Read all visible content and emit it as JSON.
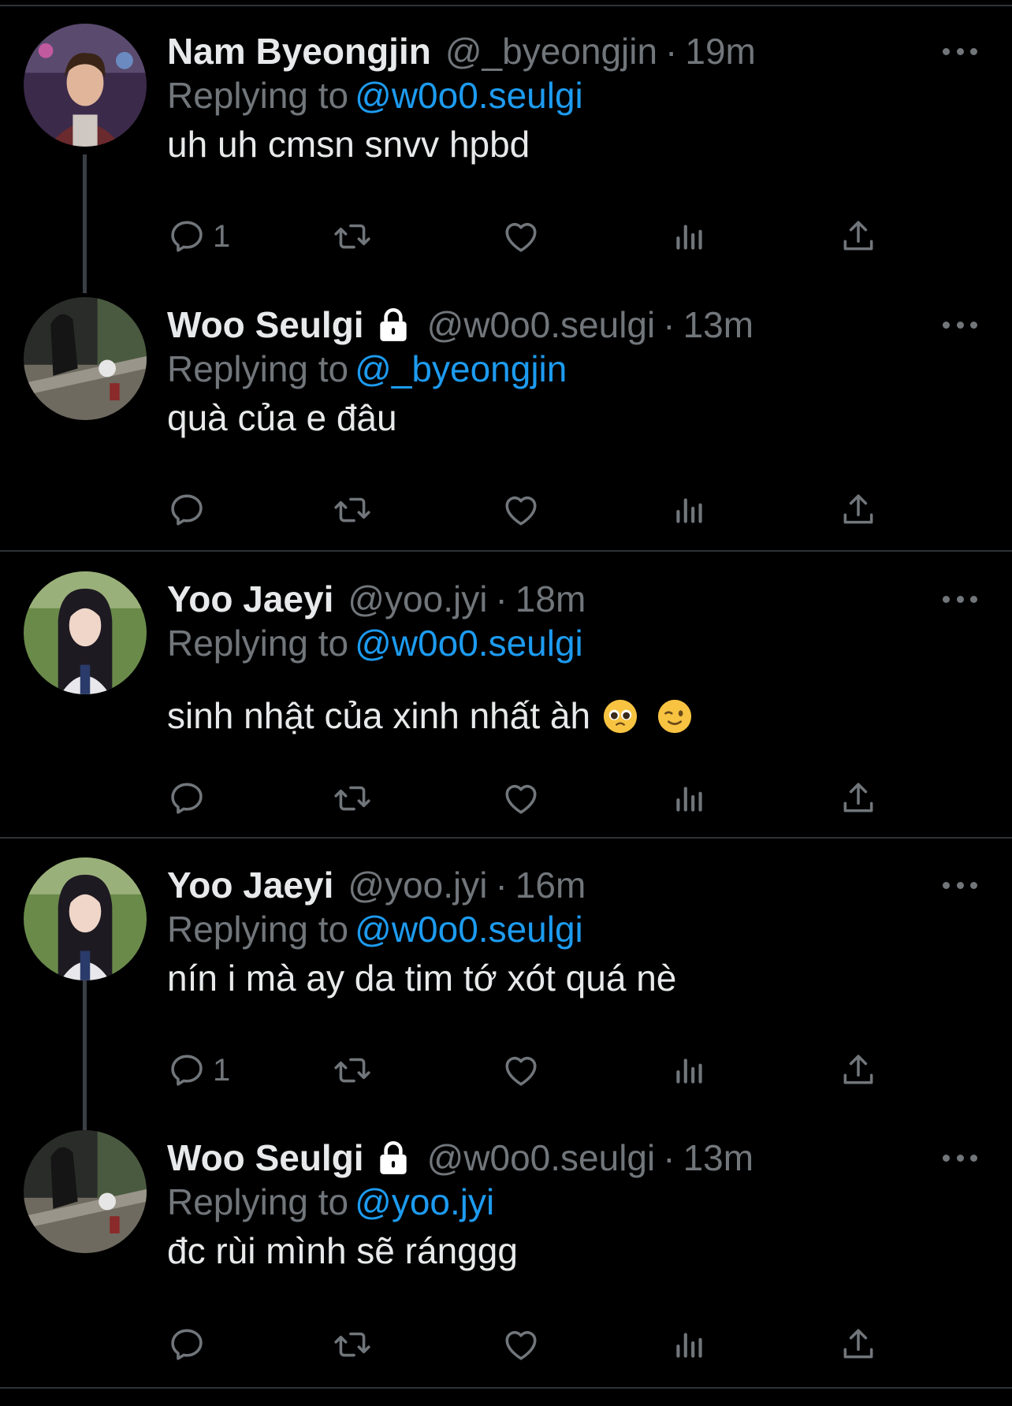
{
  "colors": {
    "background": "#000000",
    "text": "#e7e9ea",
    "muted": "#71767b",
    "link": "#1d9bf0",
    "divider": "#2f3336"
  },
  "tweets": [
    {
      "name": "Nam Byeongjin",
      "handle": "@_byeongjin",
      "separator": "·",
      "time": "19m",
      "replying_prefix": "Replying to",
      "replying_to": "@w0o0.seulgi",
      "text": "uh uh cmsn snvv hpbd",
      "reply_count": "1",
      "locked": false,
      "avatar": "male-portrait"
    },
    {
      "name": "Woo Seulgi",
      "handle": "@w0o0.seulgi",
      "separator": "·",
      "time": "13m",
      "replying_prefix": "Replying to",
      "replying_to": "@_byeongjin",
      "text": "quà của e đâu",
      "reply_count": "",
      "locked": true,
      "avatar": "street-photo"
    },
    {
      "name": "Yoo Jaeyi",
      "handle": "@yoo.jyi",
      "separator": "·",
      "time": "18m",
      "replying_prefix": "Replying to",
      "replying_to": "@w0o0.seulgi",
      "text": "sinh nhật của xinh nhất àh",
      "emojis": [
        "pleading-face",
        "winking-face"
      ],
      "reply_count": "",
      "locked": false,
      "avatar": "girl-portrait"
    },
    {
      "name": "Yoo Jaeyi",
      "handle": "@yoo.jyi",
      "separator": "·",
      "time": "16m",
      "replying_prefix": "Replying to",
      "replying_to": "@w0o0.seulgi",
      "text": "nín i mà ay da tim tớ xót quá nè",
      "reply_count": "1",
      "locked": false,
      "avatar": "girl-portrait"
    },
    {
      "name": "Woo Seulgi",
      "handle": "@w0o0.seulgi",
      "separator": "·",
      "time": "13m",
      "replying_prefix": "Replying to",
      "replying_to": "@yoo.jyi",
      "text": "đc rùi mình sẽ ránggg",
      "reply_count": "",
      "locked": true,
      "avatar": "street-photo"
    }
  ],
  "icons": {
    "reply": "reply-icon",
    "retweet": "retweet-icon",
    "like": "like-icon",
    "views": "views-icon",
    "share": "share-icon",
    "more": "more-icon",
    "lock": "lock-icon"
  }
}
